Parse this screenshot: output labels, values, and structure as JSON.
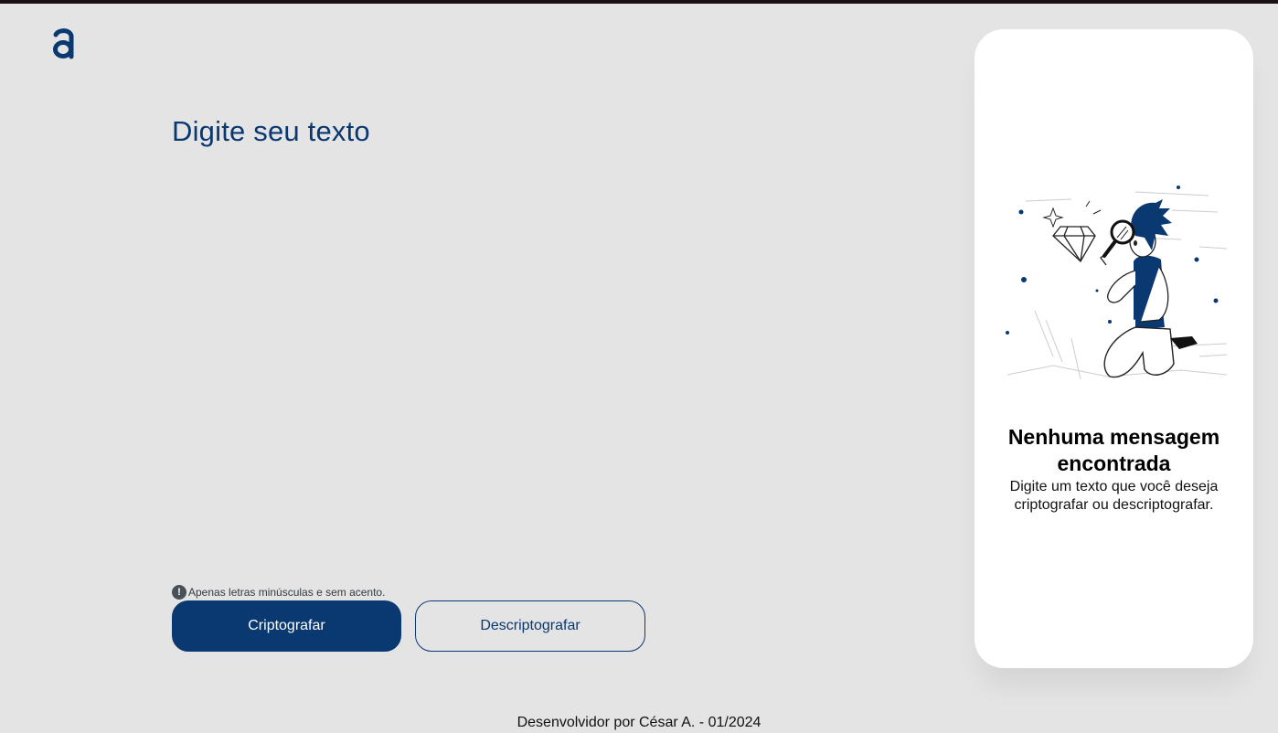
{
  "header": {
    "logo_icon": "alura-a-logo-icon",
    "brand_color": "#0a3871"
  },
  "main": {
    "title": "Digite seu texto",
    "textarea_value": "",
    "hint_icon": "exclamation-circle-icon",
    "hint_text": "Apenas letras minúsculas e sem acento.",
    "encrypt_label": "Criptografar",
    "decrypt_label": "Descriptografar"
  },
  "output": {
    "illustration_icon": "person-magnifying-glass-diamond-illustration",
    "empty_title": "Nenhuma mensagem encontrada",
    "empty_subtitle": "Digite um texto que você deseja criptografar ou descriptografar."
  },
  "footer": {
    "credit": "Desenvolvidor por César A. - 01/2024"
  }
}
